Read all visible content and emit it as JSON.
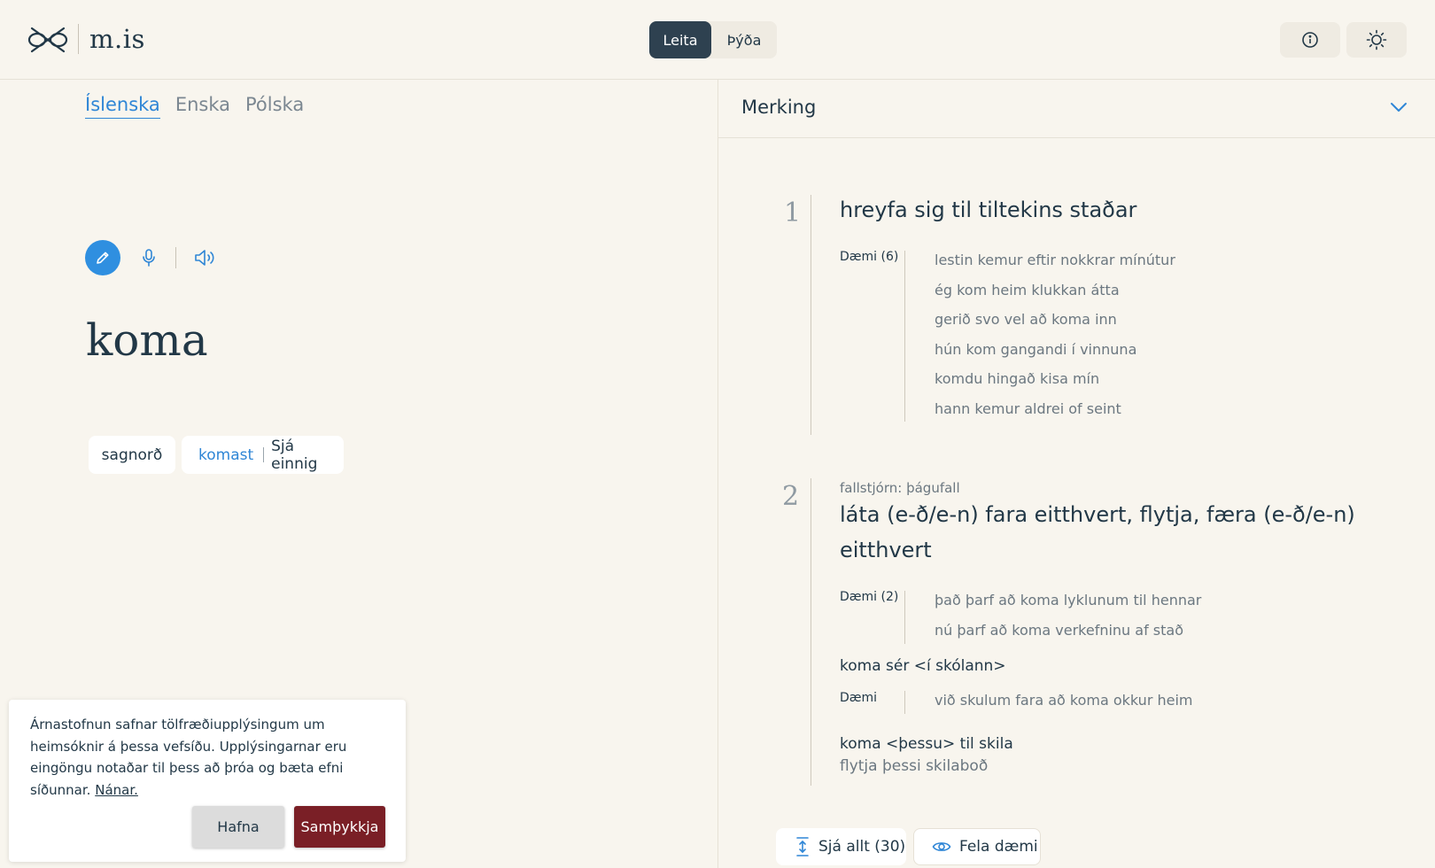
{
  "header": {
    "logo_text": "m.is",
    "mode_search": "Leita",
    "mode_translate": "Þýða"
  },
  "left": {
    "lang_tabs": [
      "Íslenska",
      "Enska",
      "Pólska"
    ],
    "headword": "koma",
    "pos": "sagnorð",
    "see_also_link": "komast",
    "see_also_label": "Sjá einnig"
  },
  "cookie": {
    "text": "Árnastofnun safnar tölfræðiupplýsingum um heimsóknir á þessa vefsíðu. Upplýsingarnar eru eingöngu notaðar til þess að þróa og bæta efni síðunnar.",
    "link": "Nánar.",
    "decline": "Hafna",
    "accept": "Samþykkja"
  },
  "right": {
    "section_title": "Merking",
    "senses": [
      {
        "num": "1",
        "definition": "hreyfa sig til tiltekins staðar",
        "examples_label": "Dæmi (6)",
        "examples": [
          "lestin kemur eftir nokkrar mínútur",
          "ég kom heim klukkan átta",
          "gerið svo vel að koma inn",
          "hún kom gangandi í vinnuna",
          "komdu hingað kisa mín",
          "hann kemur aldrei of seint"
        ]
      },
      {
        "num": "2",
        "note": "fallstjórn: þágufall",
        "definition": "láta (e-ð/e-n) fara eitthvert, flytja, færa (e-ð/e-n) eitthvert",
        "examples_label": "Dæmi (2)",
        "examples": [
          "það þarf að koma lyklunum til hennar",
          "nú þarf að koma verkefninu af stað"
        ],
        "phrase1": "koma sér <í skólann>",
        "phrase1_examples_label": "Dæmi",
        "phrase1_examples": [
          "við skulum fara að koma okkur heim"
        ],
        "phrase2": "koma <þessu> til skila",
        "phrase2_definition": "flytja þessi skilaboð"
      }
    ],
    "see_all": "Sjá allt (30)",
    "hide_examples": "Fela dæmi"
  }
}
